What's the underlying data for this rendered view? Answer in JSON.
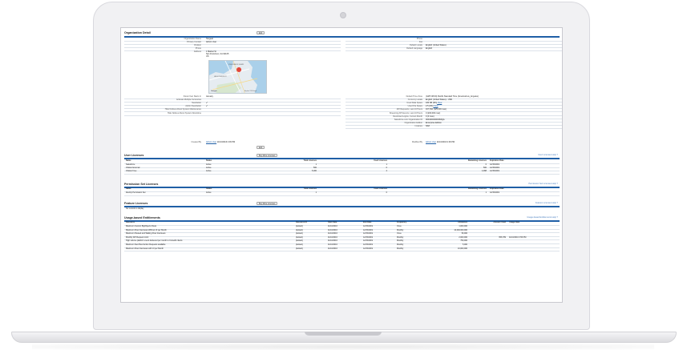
{
  "org": {
    "title": "Organization Detail",
    "edit_label": "Edit",
    "left_fields": [
      {
        "label": "Organization Name",
        "value": "Tangeat"
      },
      {
        "label": "Primary Contact",
        "value": "Admin User"
      },
      {
        "label": "Division",
        "value": ""
      },
      {
        "label": "Phone",
        "value": ""
      },
      {
        "label": "Address",
        "value": "1 Market St"
      },
      {
        "label": "",
        "value": "San Francisco, CA 94105"
      },
      {
        "label": "",
        "value": "US"
      }
    ],
    "right_fields": [
      {
        "label": "Phone",
        "value": ""
      },
      {
        "label": "Fax",
        "value": ""
      },
      {
        "label": "Default Locale",
        "value": "English (United States)"
      },
      {
        "label": "Default Language",
        "value": "English"
      }
    ],
    "lower_left": [
      {
        "label": "Fiscal Year Starts In",
        "value": "January"
      },
      {
        "label": "Activate Multiple Currencies",
        "value": ""
      },
      {
        "label": "Newsletter",
        "value": "✔"
      },
      {
        "label": "Admin Newsletter",
        "value": "✔"
      },
      {
        "label": "Hide Notices About System Maintenance",
        "value": ""
      },
      {
        "label": "Hide Notices About System Downtime",
        "value": ""
      }
    ],
    "lower_right": [
      {
        "label": "Default Time Zone",
        "value": "(GMT-08:00) Pacific Standard Time (America/Los_Angeles)"
      },
      {
        "label": "Currency Locale",
        "value": "English (United States) - USD"
      },
      {
        "label": "Used Data Space",
        "value": "430 KB (9%)",
        "link": "View"
      },
      {
        "label": "Used File Space",
        "value": "2.5 (0%)",
        "link": "View"
      },
      {
        "label": "API Requests, Last 24 Hours",
        "value": "167,540 (125,000 max)"
      },
      {
        "label": "Streaming API Events, Last 24 Hours",
        "value": "0 (200,000 max)"
      },
      {
        "label": "Restricted Logins, Current Month",
        "value": "0 (0 max)"
      },
      {
        "label": "Salesforce.com Organization ID",
        "value": "00D1I000000X8WgA"
      },
      {
        "label": "Organization Edition",
        "value": "Enterprise Edition"
      },
      {
        "label": "Instance",
        "value": "NA8"
      }
    ],
    "map_labels": [
      "FISHERMAN'S WHARF",
      "HAIGHT-ASHBURY",
      "Google",
      "Map data ©2019 Google"
    ],
    "created_by_label": "Created By",
    "created_by": "Admin User",
    "created_date": "11/10/2016 2:06 PM",
    "modified_by_label": "Modified By",
    "modified_by": "Admin User",
    "modified_date": "11/10/2016 2:06 PM"
  },
  "user_licenses": {
    "title": "User Licenses",
    "buy_label": "Buy More Licenses",
    "help": "User Licenses Help",
    "headers": [
      "Name",
      "Status",
      "Total Licenses",
      "Used Licenses",
      "Remaining Licenses",
      "Expiration Date"
    ],
    "rows": [
      [
        "Salesforce",
        "Active",
        "1",
        "1",
        "0",
        "12/15/2019"
      ],
      [
        "Chatter External",
        "Active",
        "500",
        "0",
        "500",
        "12/15/2019"
      ],
      [
        "Chatter Free",
        "Active",
        "5,000",
        "2",
        "4,998",
        "12/15/2019"
      ]
    ]
  },
  "permission_set_licenses": {
    "title": "Permission Set Licenses",
    "help": "Permission Set Licenses Help",
    "headers": [
      "Name",
      "Status",
      "Total Licenses",
      "Used Licenses",
      "Remaining Licenses",
      "Expiration Date"
    ],
    "rows": [
      [
        "Identity Permission Set",
        "Active",
        "1",
        "0",
        "1",
        "12/15/2019"
      ]
    ]
  },
  "feature_licenses": {
    "title": "Feature Licenses",
    "buy_label": "Buy More Licenses",
    "help": "Feature Licenses Help",
    "empty": "No records to display"
  },
  "entitlements": {
    "title": "Usage-based Entitlements",
    "help": "Usage-based Entitlements Help",
    "headers": [
      "Resource",
      "Resource ID",
      "Start Date",
      "End Date",
      "Frequency",
      "Allowance",
      "Amount Used",
      "Usage Date"
    ],
    "rows": [
      [
        "Maximum Custom BigObjects Rows",
        "(default)",
        "11/10/2016",
        "12/15/2019",
        "Once",
        "1,000,000",
        "",
        ""
      ],
      [
        "Maximum Flow Interviews Without UI per Month",
        "(default)",
        "11/10/2016",
        "12/15/2019",
        "Monthly",
        "10,000,000,000",
        "",
        ""
      ],
      [
        "Maximum Paused and Waiting Flow Interviews",
        "(default)",
        "11/10/2016",
        "12/15/2019",
        "Once",
        "50,000",
        "",
        ""
      ],
      [
        "Monthly API Request Limit",
        "(default)",
        "11/10/2016",
        "12/15/2019",
        "Monthly",
        "2,000,000",
        "656,789",
        "11/10/2016 3:56 PM"
      ],
      [
        "High volume platform event delivered per month to CometD clients",
        "(default)",
        "11/10/2016",
        "12/15/2019",
        "Monthly",
        "750,000",
        "",
        ""
      ],
      [
        "Maximum Next Best Action Requests available",
        "(default)",
        "11/10/2016",
        "12/15/2019",
        "Monthly",
        "5,000",
        "",
        ""
      ],
      [
        "Maximum Flow Interviews with UI per Month",
        "(default)",
        "11/10/2016",
        "12/15/2019",
        "Monthly",
        "10,000,000",
        "",
        ""
      ]
    ]
  }
}
